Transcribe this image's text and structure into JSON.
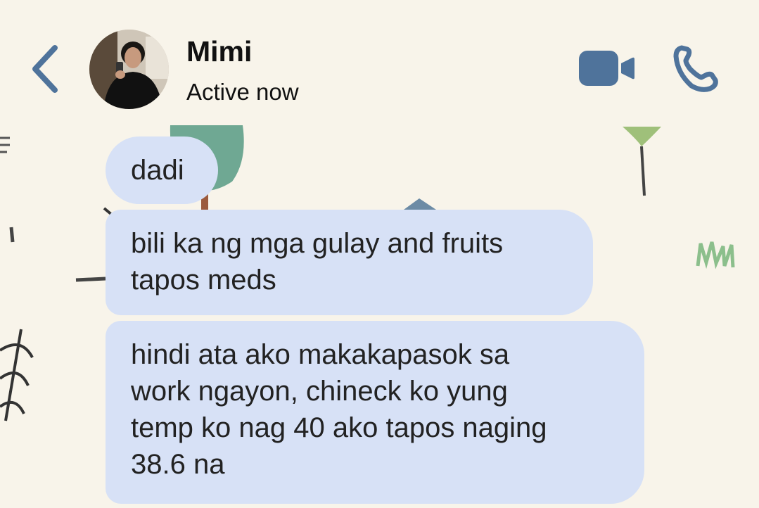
{
  "header": {
    "contact_name": "Mimi",
    "status": "Active now",
    "icons": {
      "back": "chevron-left-icon",
      "video": "video-camera-icon",
      "call": "phone-icon"
    }
  },
  "colors": {
    "accent": "#4f739b",
    "bubble": "#d7e1f6",
    "background": "#f8f4ea"
  },
  "messages": [
    {
      "lines": [
        "dadi"
      ]
    },
    {
      "lines": [
        "bili ka ng mga gulay and fruits",
        "tapos meds"
      ]
    },
    {
      "lines": [
        "hindi ata ako makakapasok sa",
        "work ngayon, chineck ko yung",
        "temp ko nag 40 ako tapos naging",
        "38.6 na"
      ]
    }
  ]
}
